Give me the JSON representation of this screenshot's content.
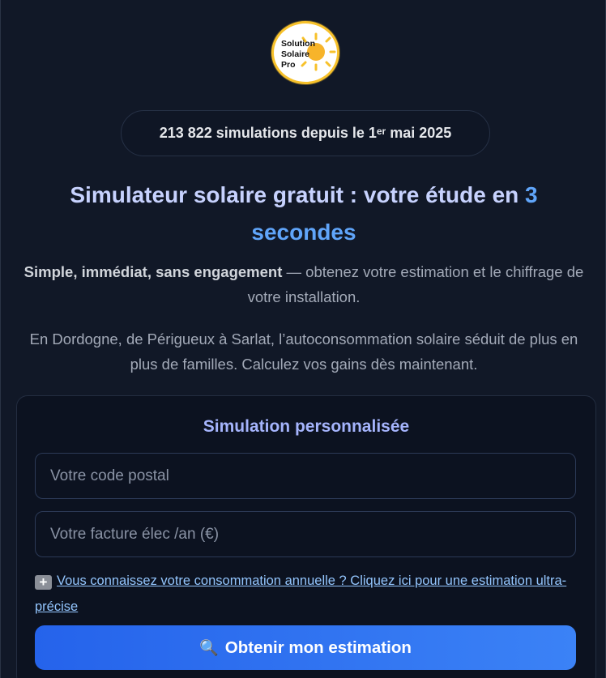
{
  "logo": {
    "line1": "Solution",
    "line2": "Solaire",
    "line3": "Pro",
    "icon": "sun-icon",
    "accent_color": "#f7c12a"
  },
  "counter": {
    "number": "213 822",
    "text_before_sup": "simulations depuis le 1",
    "sup": "er",
    "text_after_sup": " mai 2025"
  },
  "hero": {
    "title_main": "Simulateur solaire gratuit : votre étude en ",
    "title_accent": "3 secondes",
    "lead_bold": "Simple, immédiat, sans engagement",
    "lead_rest": " — obtenez votre estimation et le chiffrage de votre installation.",
    "paragraph": "En Dordogne, de Périgueux à Sarlat, l’autoconsommation solaire séduit de plus en plus de familles. Calculez vos gains dès maintenant."
  },
  "form": {
    "title": "Simulation personnalisée",
    "postal_placeholder": "Votre code postal",
    "bill_placeholder": "Votre facture élec /an (€)",
    "consumption_link_icon": "plus-icon",
    "consumption_link": "Vous connaissez votre consommation annuelle ? Cliquez ici pour une estimation ultra-précise",
    "submit_icon": "search-icon",
    "submit_label": "Obtenir mon estimation"
  },
  "colors": {
    "background": "#111827",
    "accent": "#60a5fa",
    "title": "#c7d2fe",
    "button": "#3b82f6"
  }
}
